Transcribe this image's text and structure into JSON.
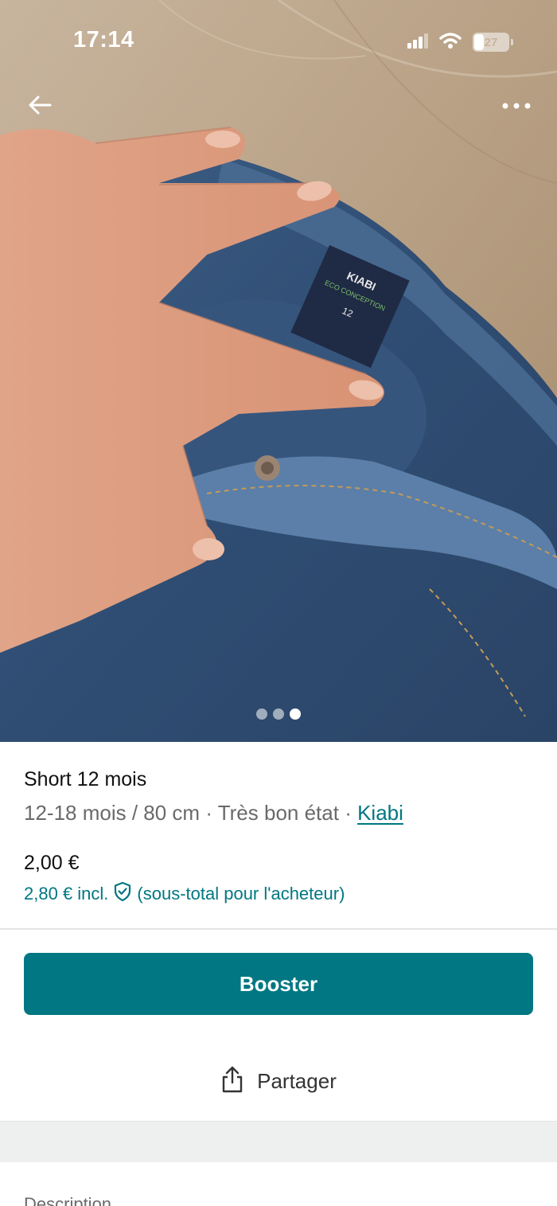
{
  "status_bar": {
    "time": "17:14",
    "battery": "27",
    "icons": [
      "signal-icon",
      "wifi-icon",
      "battery-icon"
    ]
  },
  "nav": {
    "back_icon": "arrow-left-icon",
    "more_icon": "more-horizontal-icon"
  },
  "gallery": {
    "photo_count": 3,
    "active_index": 3,
    "label_text": {
      "brand": "KIABI",
      "line": "ECO CONCEPTION",
      "size": "12"
    }
  },
  "item": {
    "title": "Short 12 mois",
    "size": "12-18 mois / 80 cm",
    "separator": " · ",
    "condition": "Très bon état",
    "brand": "Kiabi",
    "price": "2,00 €",
    "price_incl": "2,80 € incl.",
    "buyer_subtotal": "(sous-total pour l'acheteur)"
  },
  "actions": {
    "booster_label": "Booster",
    "share_label": "Partager"
  },
  "sections": {
    "description_label": "Description"
  },
  "colors": {
    "accent": "#007782",
    "divider": "#e3e5e5",
    "band": "#eef0f0"
  }
}
